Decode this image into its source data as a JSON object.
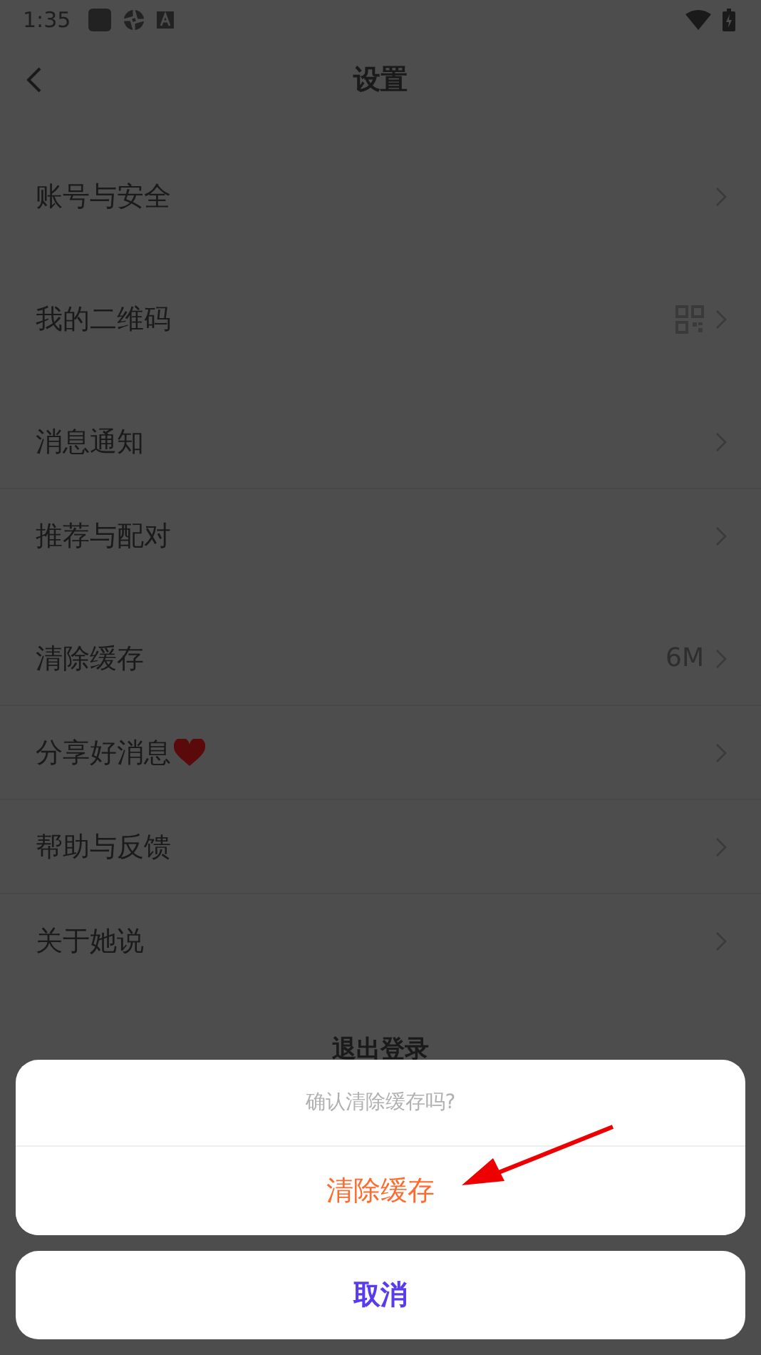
{
  "status_bar": {
    "time": "1:35"
  },
  "header": {
    "title": "设置"
  },
  "groups": [
    [
      {
        "kind": "plain",
        "label": "账号与安全"
      }
    ],
    [
      {
        "kind": "qrcode",
        "label": "我的二维码"
      }
    ],
    [
      {
        "kind": "plain",
        "label": "消息通知"
      },
      {
        "kind": "plain",
        "label": "推荐与配对"
      }
    ],
    [
      {
        "kind": "value",
        "label": "清除缓存",
        "value": "6M"
      },
      {
        "kind": "heart",
        "label": "分享好消息"
      },
      {
        "kind": "plain",
        "label": "帮助与反馈"
      },
      {
        "kind": "plain",
        "label": "关于她说"
      }
    ]
  ],
  "logout": "退出登录",
  "sheet": {
    "message": "确认清除缓存吗?",
    "action": "清除缓存",
    "cancel": "取消"
  }
}
